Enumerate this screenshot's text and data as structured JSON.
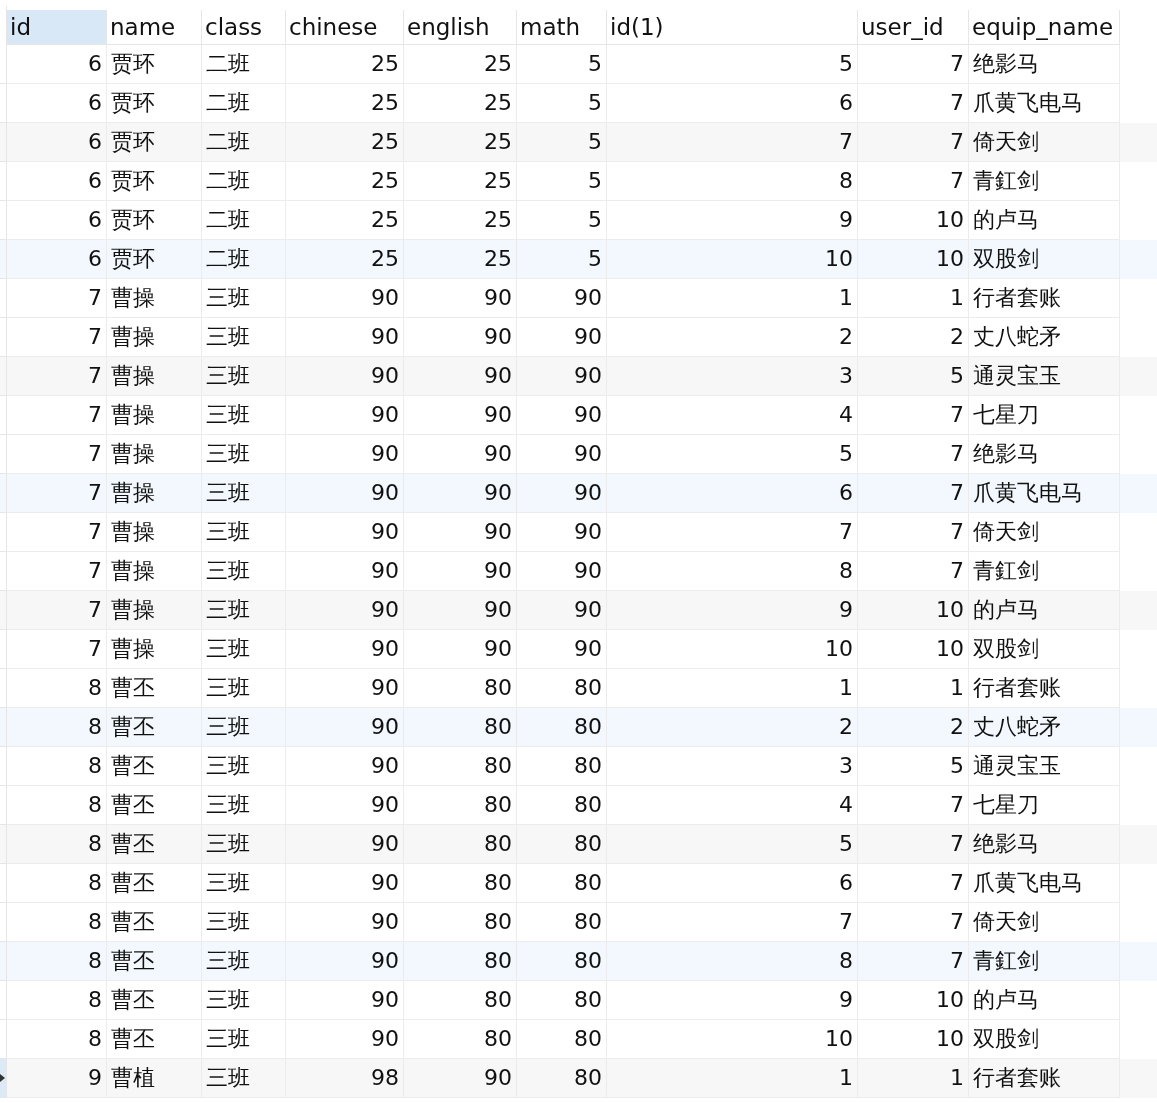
{
  "table": {
    "columns": [
      {
        "label": "id",
        "kind": "number",
        "selected": true
      },
      {
        "label": "name",
        "kind": "text",
        "selected": false
      },
      {
        "label": "class",
        "kind": "text",
        "selected": false
      },
      {
        "label": "chinese",
        "kind": "number",
        "selected": false
      },
      {
        "label": "english",
        "kind": "number",
        "selected": false
      },
      {
        "label": "math",
        "kind": "number",
        "selected": false
      },
      {
        "label": "id(1)",
        "kind": "number",
        "selected": false
      },
      {
        "label": "user_id",
        "kind": "number",
        "selected": false
      },
      {
        "label": "equip_name",
        "kind": "text",
        "selected": false
      }
    ],
    "rows": [
      {
        "kind": "plain",
        "selected": false,
        "cells": [
          "6",
          "贾环",
          "二班",
          "25",
          "25",
          "5",
          "5",
          "7",
          "绝影马"
        ]
      },
      {
        "kind": "plain",
        "selected": false,
        "cells": [
          "6",
          "贾环",
          "二班",
          "25",
          "25",
          "5",
          "6",
          "7",
          "爪黄飞电马"
        ]
      },
      {
        "kind": "shaded",
        "selected": false,
        "cells": [
          "6",
          "贾环",
          "二班",
          "25",
          "25",
          "5",
          "7",
          "7",
          "倚天剑"
        ]
      },
      {
        "kind": "plain",
        "selected": false,
        "cells": [
          "6",
          "贾环",
          "二班",
          "25",
          "25",
          "5",
          "8",
          "7",
          "青釭剑"
        ]
      },
      {
        "kind": "plain",
        "selected": false,
        "cells": [
          "6",
          "贾环",
          "二班",
          "25",
          "25",
          "5",
          "9",
          "10",
          "的卢马"
        ]
      },
      {
        "kind": "tinted",
        "selected": false,
        "cells": [
          "6",
          "贾环",
          "二班",
          "25",
          "25",
          "5",
          "10",
          "10",
          "双股剑"
        ]
      },
      {
        "kind": "plain",
        "selected": false,
        "cells": [
          "7",
          "曹操",
          "三班",
          "90",
          "90",
          "90",
          "1",
          "1",
          "行者套账"
        ]
      },
      {
        "kind": "plain",
        "selected": false,
        "cells": [
          "7",
          "曹操",
          "三班",
          "90",
          "90",
          "90",
          "2",
          "2",
          "丈八蛇矛"
        ]
      },
      {
        "kind": "shaded",
        "selected": false,
        "cells": [
          "7",
          "曹操",
          "三班",
          "90",
          "90",
          "90",
          "3",
          "5",
          "通灵宝玉"
        ]
      },
      {
        "kind": "plain",
        "selected": false,
        "cells": [
          "7",
          "曹操",
          "三班",
          "90",
          "90",
          "90",
          "4",
          "7",
          "七星刀"
        ]
      },
      {
        "kind": "plain",
        "selected": false,
        "cells": [
          "7",
          "曹操",
          "三班",
          "90",
          "90",
          "90",
          "5",
          "7",
          "绝影马"
        ]
      },
      {
        "kind": "tinted",
        "selected": false,
        "cells": [
          "7",
          "曹操",
          "三班",
          "90",
          "90",
          "90",
          "6",
          "7",
          "爪黄飞电马"
        ]
      },
      {
        "kind": "plain",
        "selected": false,
        "cells": [
          "7",
          "曹操",
          "三班",
          "90",
          "90",
          "90",
          "7",
          "7",
          "倚天剑"
        ]
      },
      {
        "kind": "plain",
        "selected": false,
        "cells": [
          "7",
          "曹操",
          "三班",
          "90",
          "90",
          "90",
          "8",
          "7",
          "青釭剑"
        ]
      },
      {
        "kind": "shaded",
        "selected": false,
        "cells": [
          "7",
          "曹操",
          "三班",
          "90",
          "90",
          "90",
          "9",
          "10",
          "的卢马"
        ]
      },
      {
        "kind": "plain",
        "selected": false,
        "cells": [
          "7",
          "曹操",
          "三班",
          "90",
          "90",
          "90",
          "10",
          "10",
          "双股剑"
        ]
      },
      {
        "kind": "plain",
        "selected": false,
        "cells": [
          "8",
          "曹丕",
          "三班",
          "90",
          "80",
          "80",
          "1",
          "1",
          "行者套账"
        ]
      },
      {
        "kind": "tinted",
        "selected": false,
        "cells": [
          "8",
          "曹丕",
          "三班",
          "90",
          "80",
          "80",
          "2",
          "2",
          "丈八蛇矛"
        ]
      },
      {
        "kind": "plain",
        "selected": false,
        "cells": [
          "8",
          "曹丕",
          "三班",
          "90",
          "80",
          "80",
          "3",
          "5",
          "通灵宝玉"
        ]
      },
      {
        "kind": "plain",
        "selected": false,
        "cells": [
          "8",
          "曹丕",
          "三班",
          "90",
          "80",
          "80",
          "4",
          "7",
          "七星刀"
        ]
      },
      {
        "kind": "shaded",
        "selected": false,
        "cells": [
          "8",
          "曹丕",
          "三班",
          "90",
          "80",
          "80",
          "5",
          "7",
          "绝影马"
        ]
      },
      {
        "kind": "plain",
        "selected": false,
        "cells": [
          "8",
          "曹丕",
          "三班",
          "90",
          "80",
          "80",
          "6",
          "7",
          "爪黄飞电马"
        ]
      },
      {
        "kind": "plain",
        "selected": false,
        "cells": [
          "8",
          "曹丕",
          "三班",
          "90",
          "80",
          "80",
          "7",
          "7",
          "倚天剑"
        ]
      },
      {
        "kind": "tinted",
        "selected": false,
        "cells": [
          "8",
          "曹丕",
          "三班",
          "90",
          "80",
          "80",
          "8",
          "7",
          "青釭剑"
        ]
      },
      {
        "kind": "plain",
        "selected": false,
        "cells": [
          "8",
          "曹丕",
          "三班",
          "90",
          "80",
          "80",
          "9",
          "10",
          "的卢马"
        ]
      },
      {
        "kind": "plain",
        "selected": false,
        "cells": [
          "8",
          "曹丕",
          "三班",
          "90",
          "80",
          "80",
          "10",
          "10",
          "双股剑"
        ]
      },
      {
        "kind": "shaded",
        "selected": true,
        "cells": [
          "9",
          "曹植",
          "三班",
          "98",
          "90",
          "80",
          "1",
          "1",
          "行者套账"
        ]
      }
    ]
  }
}
